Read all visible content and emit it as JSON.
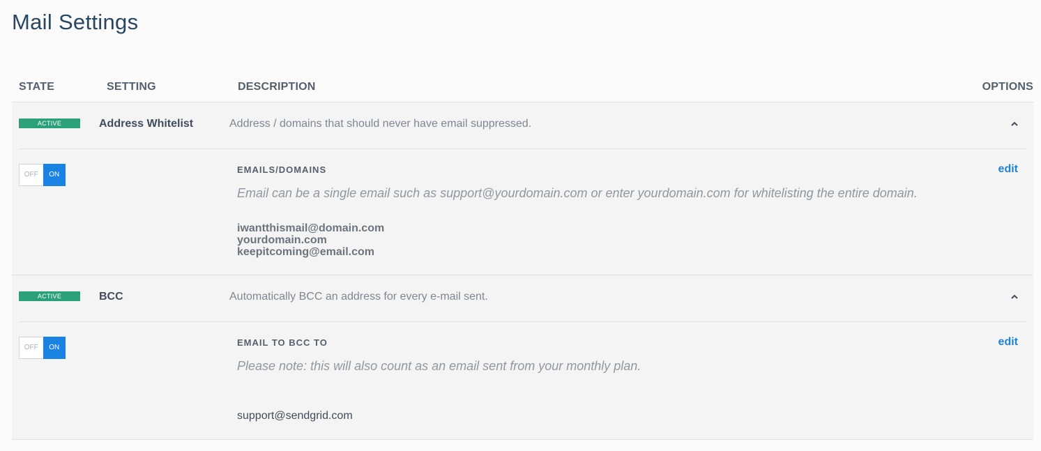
{
  "page": {
    "title": "Mail Settings"
  },
  "table": {
    "headers": {
      "state": "STATE",
      "setting": "SETTING",
      "description": "DESCRIPTION",
      "options": "OPTIONS"
    }
  },
  "settings": [
    {
      "badge": "ACTIVE",
      "name": "Address Whitelist",
      "description": "Address / domains that should never have email suppressed.",
      "toggle": {
        "off": "OFF",
        "on": "ON",
        "state": "on"
      },
      "field_label": "EMAILS/DOMAINS",
      "field_help": "Email can be a single email such as support@yourdomain.com or enter yourdomain.com for whitelisting the entire domain.",
      "edit_label": "edit",
      "values": [
        "iwantthismail@domain.com",
        "yourdomain.com",
        "keepitcoming@email.com"
      ]
    },
    {
      "badge": "ACTIVE",
      "name": "BCC",
      "description": "Automatically BCC an address for every e-mail sent.",
      "toggle": {
        "off": "OFF",
        "on": "ON",
        "state": "on"
      },
      "field_label": "EMAIL TO BCC TO",
      "field_help": "Please note: this will also count as an email sent from your monthly plan.",
      "edit_label": "edit",
      "value": "support@sendgrid.com"
    }
  ],
  "colors": {
    "active_badge": "#2ba07a",
    "toggle_on": "#1a82e2",
    "link": "#1a82e2"
  }
}
